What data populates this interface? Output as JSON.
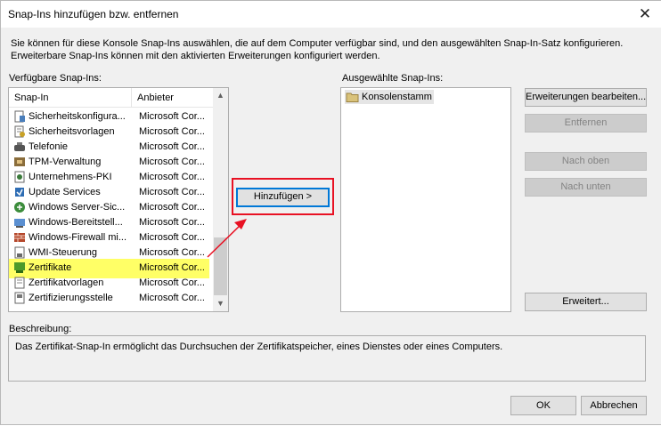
{
  "window": {
    "title": "Snap-Ins hinzufügen bzw. entfernen",
    "close_glyph": "✕"
  },
  "intro": "Sie können für diese Konsole Snap-Ins auswählen, die auf dem Computer verfügbar sind, und den ausgewählten Snap-In-Satz konfigurieren. Erweiterbare Snap-Ins können mit den aktivierten Erweiterungen konfiguriert werden.",
  "available": {
    "label": "Verfügbare Snap-Ins:",
    "col_snapin": "Snap-In",
    "col_vendor": "Anbieter",
    "items": [
      {
        "name": "Sicherheitskonfigura...",
        "vendor": "Microsoft Cor...",
        "icon": "security-config-icon"
      },
      {
        "name": "Sicherheitsvorlagen",
        "vendor": "Microsoft Cor...",
        "icon": "security-templates-icon"
      },
      {
        "name": "Telefonie",
        "vendor": "Microsoft Cor...",
        "icon": "telephony-icon"
      },
      {
        "name": "TPM-Verwaltung",
        "vendor": "Microsoft Cor...",
        "icon": "tpm-icon"
      },
      {
        "name": "Unternehmens-PKI",
        "vendor": "Microsoft Cor...",
        "icon": "pki-icon"
      },
      {
        "name": "Update Services",
        "vendor": "Microsoft Cor...",
        "icon": "update-services-icon"
      },
      {
        "name": "Windows Server-Sic...",
        "vendor": "Microsoft Cor...",
        "icon": "server-backup-icon"
      },
      {
        "name": "Windows-Bereitstell...",
        "vendor": "Microsoft Cor...",
        "icon": "deployment-icon"
      },
      {
        "name": "Windows-Firewall mi...",
        "vendor": "Microsoft Cor...",
        "icon": "firewall-icon"
      },
      {
        "name": "WMI-Steuerung",
        "vendor": "Microsoft Cor...",
        "icon": "wmi-icon"
      },
      {
        "name": "Zertifikate",
        "vendor": "Microsoft Cor...",
        "icon": "certificates-icon"
      },
      {
        "name": "Zertifikatvorlagen",
        "vendor": "Microsoft Cor...",
        "icon": "certificate-templates-icon"
      },
      {
        "name": "Zertifizierungsstelle",
        "vendor": "Microsoft Cor...",
        "icon": "certification-authority-icon"
      }
    ]
  },
  "selected": {
    "label": "Ausgewählte Snap-Ins:",
    "items": [
      {
        "name": "Konsolenstamm",
        "icon": "folder-icon"
      }
    ]
  },
  "buttons": {
    "add": "Hinzufügen >",
    "edit_extensions": "Erweiterungen bearbeiten...",
    "remove": "Entfernen",
    "move_up": "Nach oben",
    "move_down": "Nach unten",
    "advanced": "Erweitert...",
    "ok": "OK",
    "cancel": "Abbrechen"
  },
  "description": {
    "label": "Beschreibung:",
    "text": "Das Zertifikat-Snap-In ermöglicht das Durchsuchen der Zertifikatspeicher, eines Dienstes oder eines Computers."
  },
  "annotation_colors": {
    "highlight": "#ffff66",
    "box": "#e81123",
    "arrow": "#e81123"
  }
}
